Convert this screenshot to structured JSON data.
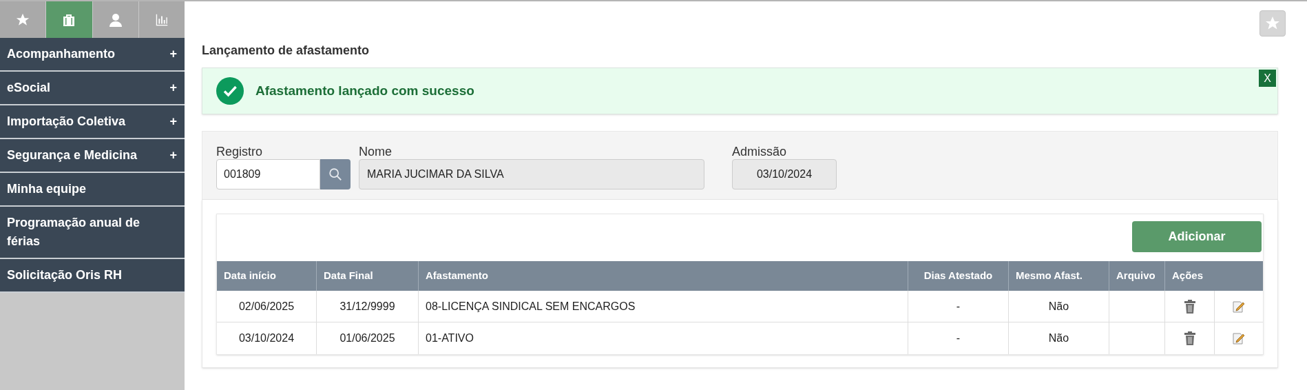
{
  "sidebar": {
    "tabs": [
      {
        "kind": "star",
        "selected": false
      },
      {
        "kind": "briefcase",
        "selected": true
      },
      {
        "kind": "person",
        "selected": false
      },
      {
        "kind": "chart",
        "selected": false
      }
    ],
    "items": [
      {
        "label": "Acompanhamento",
        "expandable": true
      },
      {
        "label": "eSocial",
        "expandable": true
      },
      {
        "label": "Importação Coletiva",
        "expandable": true
      },
      {
        "label": "Segurança e Medicina",
        "expandable": true
      },
      {
        "label": "Minha equipe",
        "expandable": false
      },
      {
        "label": "Programação anual de férias",
        "expandable": false
      },
      {
        "label": "Solicitação Oris RH",
        "expandable": false
      }
    ],
    "expand_symbol": "+"
  },
  "page": {
    "title": "Lançamento de afastamento"
  },
  "alert": {
    "message": "Afastamento lançado com sucesso",
    "close": "X"
  },
  "form": {
    "registro": {
      "label": "Registro",
      "value": "001809"
    },
    "nome": {
      "label": "Nome",
      "value": "MARIA JUCIMAR DA SILVA"
    },
    "admissao": {
      "label": "Admissão",
      "value": "03/10/2024"
    }
  },
  "add_button": "Adicionar",
  "table": {
    "columns": [
      "Data início",
      "Data Final",
      "Afastamento",
      "Dias Atestado",
      "Mesmo Afast.",
      "Arquivo",
      "Ações"
    ],
    "rows": [
      {
        "cells": [
          "02/06/2025",
          "31/12/9999",
          "08-LICENÇA SINDICAL SEM ENCARGOS",
          "-",
          "Não"
        ]
      },
      {
        "cells": [
          "03/10/2024",
          "01/06/2025",
          "01-ATIVO",
          "-",
          "Não"
        ]
      }
    ]
  }
}
